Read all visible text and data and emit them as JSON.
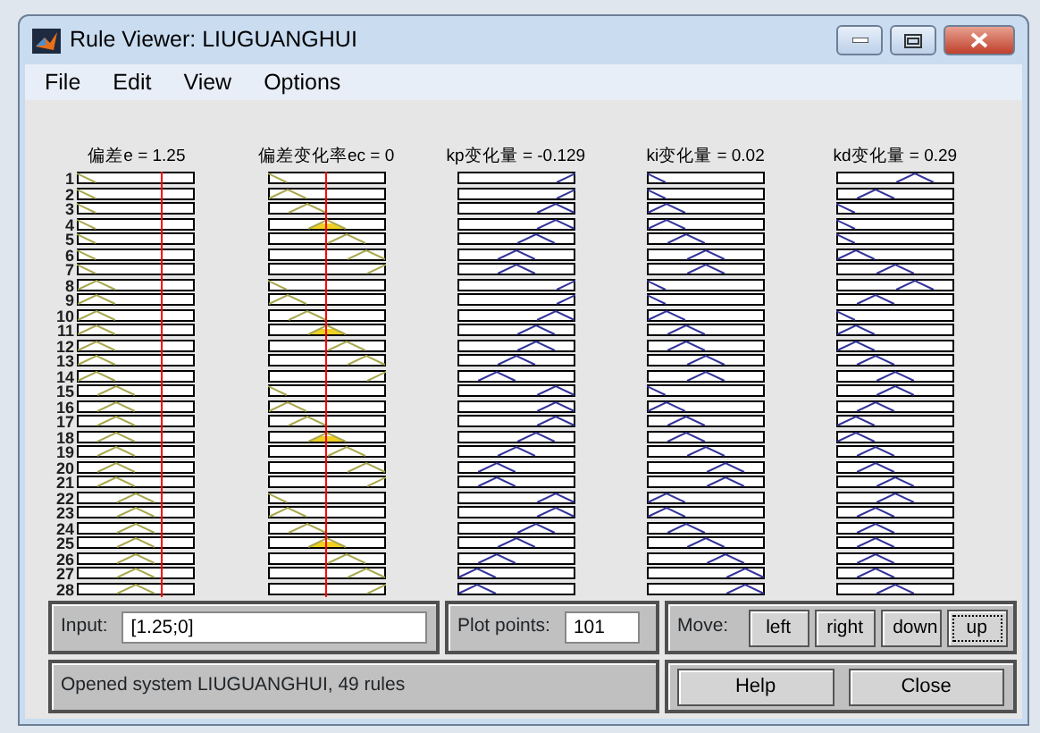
{
  "window": {
    "title": "Rule Viewer: LIUGUANGHUI"
  },
  "menu": [
    {
      "label": "File"
    },
    {
      "label": "Edit"
    },
    {
      "label": "View"
    },
    {
      "label": "Options"
    }
  ],
  "variables": [
    {
      "label": "偏差e = 1.25",
      "kind": "input"
    },
    {
      "label": "偏差变化率ec = 0",
      "kind": "input"
    },
    {
      "label": "kp变化量 = -0.129",
      "kind": "output"
    },
    {
      "label": "ki变化量 = 0.02",
      "kind": "output"
    },
    {
      "label": "kd变化量 = 0.29",
      "kind": "output"
    }
  ],
  "rules": [
    {
      "number": "1"
    },
    {
      "number": "2"
    },
    {
      "number": "3"
    },
    {
      "number": "4"
    },
    {
      "number": "5"
    },
    {
      "number": "6"
    },
    {
      "number": "7"
    },
    {
      "number": "8"
    },
    {
      "number": "9"
    },
    {
      "number": "10"
    },
    {
      "number": "11"
    },
    {
      "number": "12"
    },
    {
      "number": "13"
    },
    {
      "number": "14"
    },
    {
      "number": "15"
    },
    {
      "number": "16"
    },
    {
      "number": "17"
    },
    {
      "number": "18"
    },
    {
      "number": "19"
    },
    {
      "number": "20"
    },
    {
      "number": "21"
    },
    {
      "number": "22"
    },
    {
      "number": "23"
    },
    {
      "number": "24"
    },
    {
      "number": "25"
    },
    {
      "number": "26"
    },
    {
      "number": "27"
    },
    {
      "number": "28"
    }
  ],
  "input": {
    "label": "Input:",
    "value": "[1.25;0]"
  },
  "plot_points": {
    "label": "Plot points:",
    "value": "101"
  },
  "move": {
    "label": "Move:",
    "buttons": [
      {
        "label": "left",
        "focused": false
      },
      {
        "label": "right",
        "focused": false
      },
      {
        "label": "down",
        "focused": false
      },
      {
        "label": "up",
        "focused": true
      }
    ]
  },
  "status": "Opened system LIUGUANGHUI, 49 rules",
  "buttons": [
    {
      "label": "Help"
    },
    {
      "label": "Close"
    }
  ]
}
